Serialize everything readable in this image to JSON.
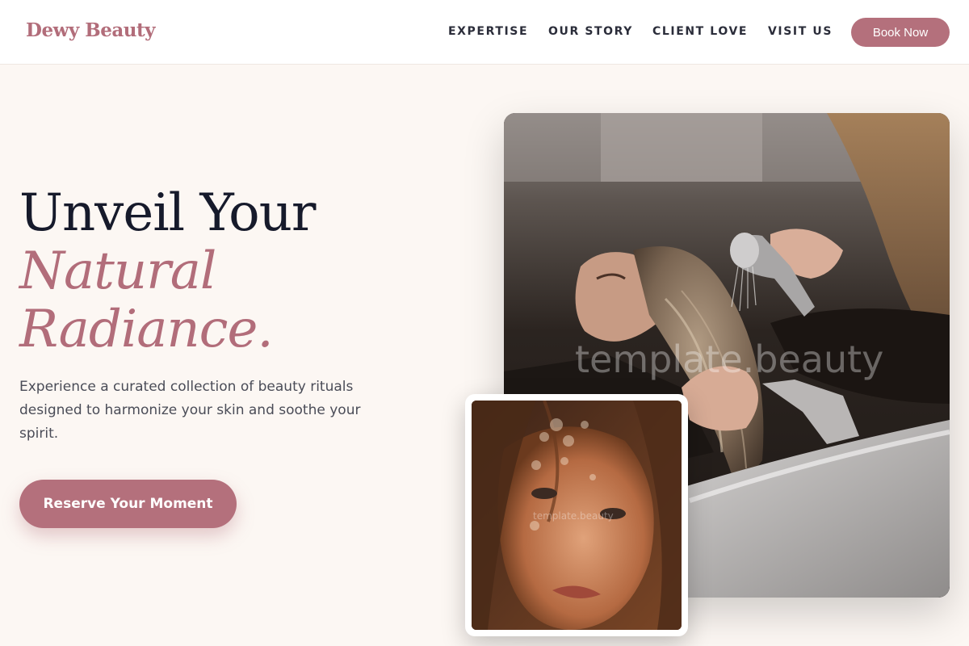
{
  "brand": {
    "name": "Dewy Beauty",
    "accent_color": "#b4707c"
  },
  "nav": {
    "items": [
      "EXPERTISE",
      "OUR STORY",
      "CLIENT LOVE",
      "VISIT US"
    ],
    "book_label": "Book Now"
  },
  "hero": {
    "line1": "Unveil Your",
    "line2": "Natural",
    "line3": "Radiance.",
    "description": "Experience a curated collection of beauty rituals designed to harmonize your skin and soothe your spirit.",
    "cta_label": "Reserve Your Moment"
  },
  "images": {
    "main_watermark": "template.beauty",
    "small_watermark": "template.beauty"
  }
}
